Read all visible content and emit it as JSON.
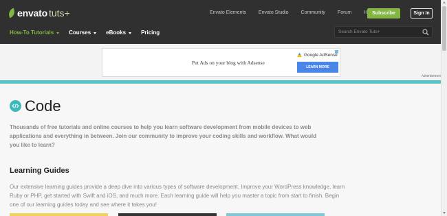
{
  "header": {
    "logo_envato": "envato",
    "logo_tuts": "tuts+",
    "top_links": [
      "Envato Elements",
      "Envato Studio",
      "Community",
      "Forum",
      "Help"
    ],
    "subscribe_label": "Subscribe",
    "signin_label": "Sign In",
    "nav": [
      {
        "label": "How-To Tutorials",
        "dropdown": true,
        "active": true
      },
      {
        "label": "Courses",
        "dropdown": true,
        "active": false
      },
      {
        "label": "eBooks",
        "dropdown": true,
        "active": false
      },
      {
        "label": "Pricing",
        "dropdown": false,
        "active": false
      }
    ],
    "search_placeholder": "Search Envato Tuts+"
  },
  "ad": {
    "text": "Put Ads on your blog with Adsense",
    "brand": "Google AdSense",
    "cta": "LEARN MORE",
    "label": "Advertisement"
  },
  "main": {
    "title": "Code",
    "intro": "Thousands of free tutorials and online courses to help you learn software development from mobile devices to web applications and everything in between. Join our community to improve your coding skills and workflow. What would you like to learn?",
    "section_heading": "Learning Guides",
    "section_text": "Our extensive learning guides provide a deep dive into various types of software development. Improve your WordPress knowledge, learn Ruby or PHP, get started with Swift and iOS, and much more. Each learning guide will help you master a topic from start to finish. Begin one of our learning guides today and see where it takes you!"
  },
  "colors": {
    "accent_green": "#82b541",
    "teal": "#56c5c5",
    "header_bg": "#303030"
  }
}
